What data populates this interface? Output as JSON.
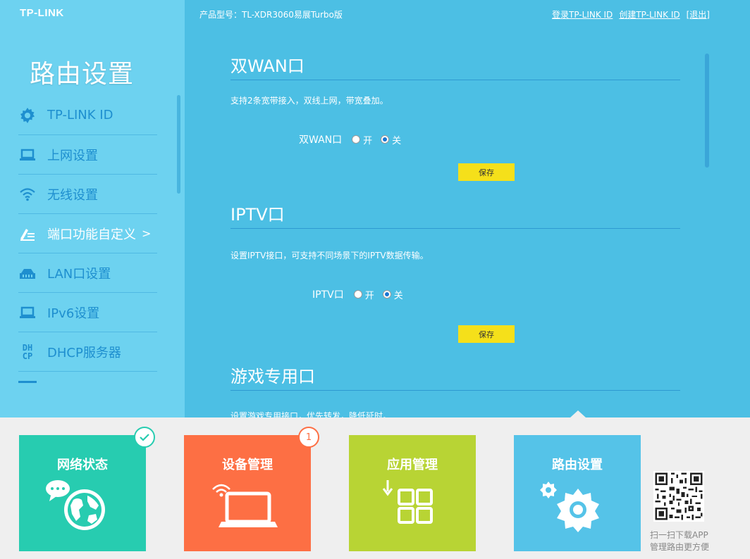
{
  "brand": {
    "logo": "TP-LINK"
  },
  "header": {
    "model": "产品型号：TL-XDR3060易展Turbo版",
    "login": "登录TP-LINK ID",
    "create": "创建TP-LINK ID",
    "logout": "[退出]"
  },
  "sidebar": {
    "title": "路由设置",
    "items": [
      {
        "label": "TP-LINK ID",
        "icon": "gear-icon"
      },
      {
        "label": "上网设置",
        "icon": "laptop-icon"
      },
      {
        "label": "无线设置",
        "icon": "wifi-icon"
      },
      {
        "label": "端口功能自定义",
        "icon": "port-custom-icon",
        "chevron": ">"
      },
      {
        "label": "LAN口设置",
        "icon": "lan-icon"
      },
      {
        "label": "IPv6设置",
        "icon": "laptop-icon"
      },
      {
        "label": "DHCP服务器",
        "icon": "dhcp-icon",
        "icon_text": [
          "DH",
          "CP"
        ]
      }
    ]
  },
  "sections": {
    "dual_wan": {
      "title": "双WAN口",
      "desc": "支持2条宽带接入，双线上网，带宽叠加。",
      "field_label": "双WAN口",
      "on_label": "开",
      "off_label": "关",
      "value": "off",
      "save_label": "保存"
    },
    "iptv": {
      "title": "IPTV口",
      "desc": "设置IPTV接口，可支持不同场景下的IPTV数据传输。",
      "field_label": "IPTV口",
      "on_label": "开",
      "off_label": "关",
      "value": "off",
      "save_label": "保存"
    },
    "game": {
      "title": "游戏专用口",
      "desc": "设置游戏专用接口，优先转发，降低延时。"
    }
  },
  "tiles": [
    {
      "label": "网络状态",
      "color": "#27ccb0",
      "badge": "check"
    },
    {
      "label": "设备管理",
      "color": "#fd6f44",
      "badge": "1"
    },
    {
      "label": "应用管理",
      "color": "#b8d434"
    },
    {
      "label": "路由设置",
      "color": "#55c3e8",
      "active": true
    }
  ],
  "qr": {
    "line1": "扫一扫下载APP",
    "line2": "管理路由更方便"
  },
  "colors": {
    "main_bg": "#4cbfe4",
    "sidebar_bg": "#6dd2f0",
    "menu_text": "#1e8fcf",
    "save_btn": "#f5e01a"
  }
}
